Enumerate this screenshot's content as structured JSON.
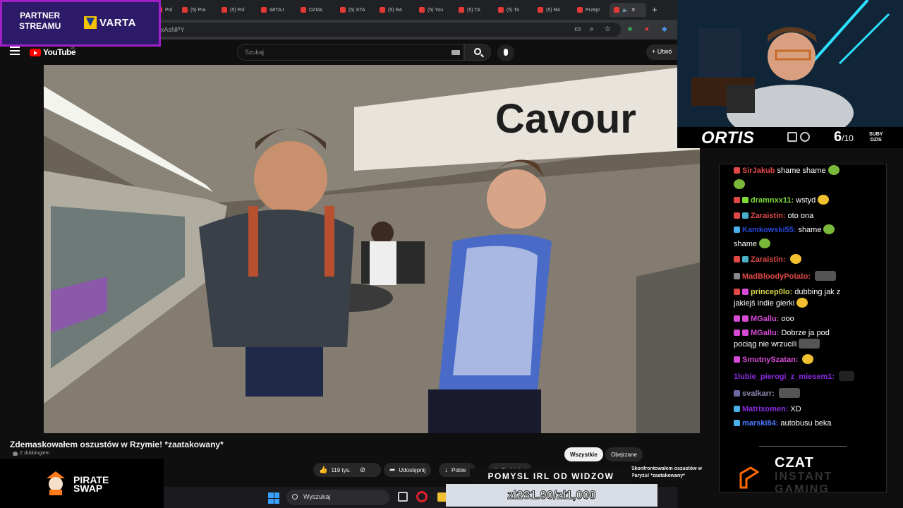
{
  "browser": {
    "tabs": [
      {
        "label": "Pol"
      },
      {
        "label": "(5) Pra"
      },
      {
        "label": "(5) Pol"
      },
      {
        "label": "WITAJ"
      },
      {
        "label": "DZIAŁ"
      },
      {
        "label": "(5) STA"
      },
      {
        "label": "(5) RA"
      },
      {
        "label": "(5) You"
      },
      {
        "label": "(5) TA"
      },
      {
        "label": "(5) Ta"
      },
      {
        "label": "(5) RA"
      },
      {
        "label": "Przepr"
      }
    ],
    "active_tab_mute_icon": "speaker-icon",
    "new_tab": "+",
    "url_suffix": "xAsNPY"
  },
  "youtube": {
    "logo_text": "YouTube",
    "country": "PL",
    "search_placeholder": "Szukaj",
    "create_label": "Utwó",
    "video_sign_text": "Cavour",
    "title": "Zdemaskowałem oszustów w Rzymie! *zaatakowany*",
    "dub_note": "Z dubbingiem",
    "likes": "119 tys.",
    "share": "Udostępnij",
    "download": "Pobie",
    "partial_button": "Podziękuj",
    "filters": {
      "all": "Wszystkie",
      "watched": "Obejrzane"
    },
    "recommended_peek": {
      "title": "Skonfrontowałem oszustów w",
      "sub": "Paryżu! *zaatakowany*"
    }
  },
  "overlay": {
    "partner_line1": "PARTNER",
    "partner_line2": "STREAMU",
    "sponsor_brand": "VARTA",
    "streamer": "ORTIS",
    "subs_current": "6",
    "subs_goal": "/10",
    "subs_label_1": "SUBY",
    "subs_label_2": "DZIS",
    "pirate_1": "PIRATE",
    "pirate_2": "SWAP",
    "donation_title": "POMYSL IRL OD WIDZOW",
    "donation_amount": "zł281.90/zł1,000",
    "czat_1": "CZAT",
    "czat_2": "INSTANT",
    "czat_3": "GAMING"
  },
  "chat": {
    "messages": [
      {
        "user": "SirJakub",
        "text": "shame shame",
        "color": "#e04848"
      },
      {
        "user": "",
        "text": "",
        "color": "#ffffff"
      },
      {
        "user": "dramnxx11:",
        "text": "wstyd",
        "color": "#7ddc3a"
      },
      {
        "user": "Zaraistin:",
        "text": "oto ona",
        "color": "#e04848"
      },
      {
        "user": "Kamkowski55:",
        "text": "shame",
        "color": "#2a48d8"
      },
      {
        "user": "",
        "text": "shame",
        "color": "#ffffff"
      },
      {
        "user": "Zaraistin:",
        "text": "",
        "color": "#e04848"
      },
      {
        "user": "MadBloodyPotato:",
        "text": "",
        "color": "#e04848"
      },
      {
        "user": "princep0lo:",
        "text": "dubbing jak z",
        "color": "#d6d64a"
      },
      {
        "user": "",
        "text": "jakiejś indie gierki",
        "color": "#ffffff"
      },
      {
        "user": "MGallu:",
        "text": "ooo",
        "color": "#d64ad6"
      },
      {
        "user": "MGallu:",
        "text": "Dobrze ja pod",
        "color": "#d64ad6"
      },
      {
        "user": "",
        "text": "pociąg nie wrzucili",
        "color": "#ffffff"
      },
      {
        "user": "SmutnySzatan:",
        "text": "",
        "color": "#d64ad6"
      },
      {
        "user": "1lubie_pierogi_z_miesem1:",
        "text": "",
        "color": "#8a2ae0"
      },
      {
        "user": "svalkarr:",
        "text": "",
        "color": "#8a8ab0"
      },
      {
        "user": "Matrixomen:",
        "text": "XD",
        "color": "#8a2ae0"
      },
      {
        "user": "marski84:",
        "text": "autobusu beka",
        "color": "#4a7cff"
      }
    ]
  },
  "taskbar": {
    "search": "Wyszukaj"
  },
  "colors": {
    "accent": "#ff0000",
    "banner": "#2d1b69",
    "banner_border": "#a020c8"
  }
}
